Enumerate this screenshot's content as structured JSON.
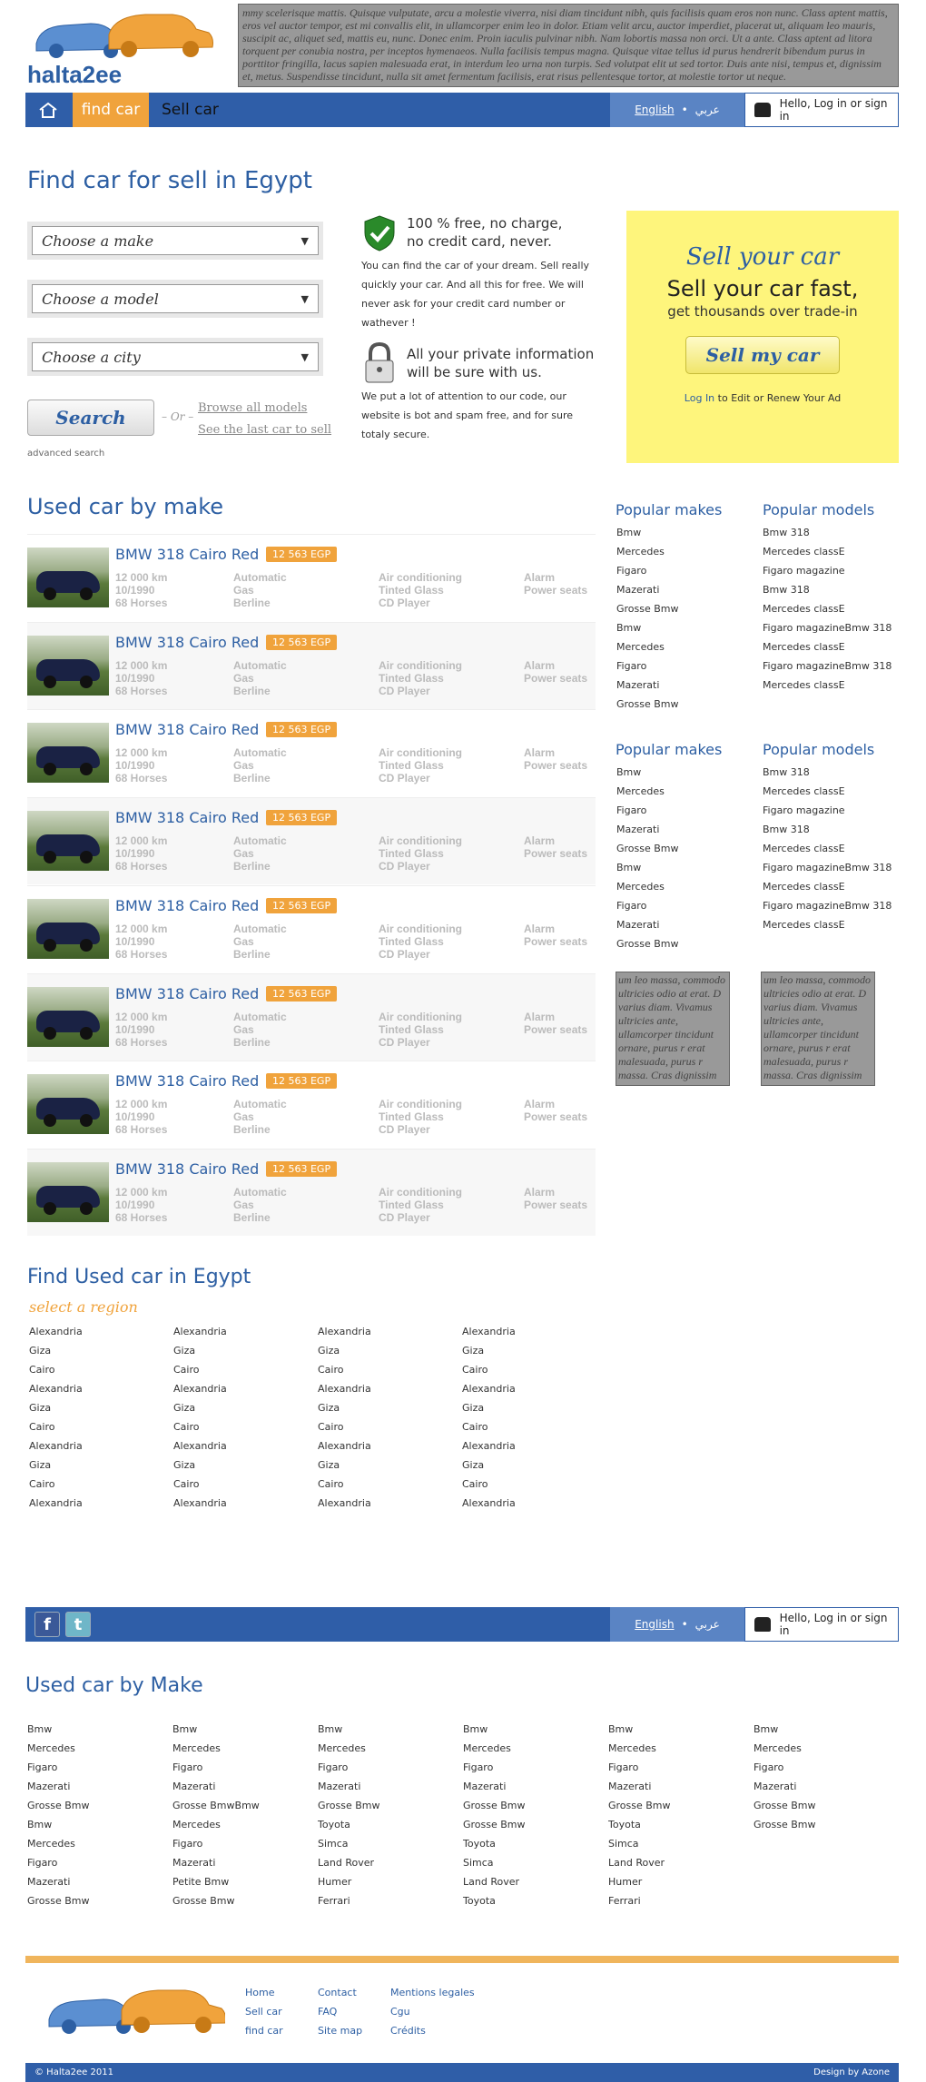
{
  "header": {
    "logo_text": "halta2ee",
    "lorem": "mmy scelerisque mattis. Quisque vulputate, arcu a molestie viverra, nisi diam tincidunt nibh, quis facilisis quam eros non nunc. Class aptent mattis, eros vel auctor tempor, est mi convallis elit, in ullamcorper enim leo in dolor. Etiam velit arcu, auctor imperdiet, placerat ut, aliquam leo mauris, suscipit ac, aliquet sed, mattis eu, nunc. Donec enim. Proin iaculis pulvinar nibh. Nam lobortis massa non orci. Ut a ante. Class aptent ad litora torquent per conubia nostra, per inceptos hymenaeos. Nulla facilisis tempus magna. Quisque vitae tellus id purus hendrerit bibendum purus in porttitor fringilla, lacus sapien malesuada erat, in interdum leo urna non turpis. Sed volutpat elit ut sed tortor. Duis ante nisi, tempus et, dignissim et, metus. Suspendisse tincidunt, nulla sit amet fermentum facilisis, erat risus pellentesque tortor, at molestie tortor ut neque."
  },
  "nav": {
    "home": "home",
    "find_car": "find car",
    "sell_car": "Sell car",
    "lang_en": "English",
    "lang_ar": "عربي",
    "hello": "Hello, Log in or sign in"
  },
  "search": {
    "title": "Find car for sell in Egypt",
    "make": "Choose a make",
    "model": "Choose a model",
    "city": "Choose a city",
    "button": "Search",
    "or": "– Or –",
    "browse": "Browse all models",
    "last": "See the last car to sell",
    "advanced": "advanced search"
  },
  "info": {
    "free_title_1": "100 % free, no charge,",
    "free_title_2": "no credit card, never.",
    "free_text": "You can find the car of your dream. Sell really quickly your car. And all this for free. We will never ask for your credit card number or wathever !",
    "private_title_1": "All your private information",
    "private_title_2": "will be sure with us.",
    "private_text": "We put a lot of attention to our code, our website is bot and spam free, and for sure totaly secure."
  },
  "sell_box": {
    "title": "Sell your car",
    "subtitle": "Sell your car fast,",
    "sub2": "get thousands over trade-in",
    "button": "Sell my car",
    "login": "Log In",
    "login_rest": " to Edit or Renew Your Ad"
  },
  "used_by_make": {
    "title": "Used car by make",
    "cars": [
      {
        "title": "BMW 318 Cairo Red",
        "price": "12 563 EGP",
        "c1": [
          "12 000 km",
          "10/1990",
          "68 Horses"
        ],
        "c2": [
          "Automatic",
          "Gas",
          "Berline"
        ],
        "c3": [
          "Air conditioning",
          "Tinted Glass",
          "CD Player"
        ],
        "c4": [
          "Alarm",
          "Power seats"
        ]
      },
      {
        "title": "BMW 318 Cairo Red",
        "price": "12 563 EGP",
        "c1": [
          "12 000 km",
          "10/1990",
          "68 Horses"
        ],
        "c2": [
          "Automatic",
          "Gas",
          "Berline"
        ],
        "c3": [
          "Air conditioning",
          "Tinted Glass",
          "CD Player"
        ],
        "c4": [
          "Alarm",
          "Power seats"
        ]
      },
      {
        "title": "BMW 318 Cairo Red",
        "price": "12 563 EGP",
        "c1": [
          "12 000 km",
          "10/1990",
          "68 Horses"
        ],
        "c2": [
          "Automatic",
          "Gas",
          "Berline"
        ],
        "c3": [
          "Air conditioning",
          "Tinted Glass",
          "CD Player"
        ],
        "c4": [
          "Alarm",
          "Power seats"
        ]
      },
      {
        "title": "BMW 318 Cairo Red",
        "price": "12 563 EGP",
        "c1": [
          "12 000 km",
          "10/1990",
          "68 Horses"
        ],
        "c2": [
          "Automatic",
          "Gas",
          "Berline"
        ],
        "c3": [
          "Air conditioning",
          "Tinted Glass",
          "CD Player"
        ],
        "c4": [
          "Alarm",
          "Power seats"
        ]
      },
      {
        "title": "BMW 318 Cairo Red",
        "price": "12 563 EGP",
        "c1": [
          "12 000 km",
          "10/1990",
          "68 Horses"
        ],
        "c2": [
          "Automatic",
          "Gas",
          "Berline"
        ],
        "c3": [
          "Air conditioning",
          "Tinted Glass",
          "CD Player"
        ],
        "c4": [
          "Alarm",
          "Power seats"
        ]
      },
      {
        "title": "BMW 318 Cairo Red",
        "price": "12 563 EGP",
        "c1": [
          "12 000 km",
          "10/1990",
          "68 Horses"
        ],
        "c2": [
          "Automatic",
          "Gas",
          "Berline"
        ],
        "c3": [
          "Air conditioning",
          "Tinted Glass",
          "CD Player"
        ],
        "c4": [
          "Alarm",
          "Power seats"
        ]
      },
      {
        "title": "BMW 318 Cairo Red",
        "price": "12 563 EGP",
        "c1": [
          "12 000 km",
          "10/1990",
          "68 Horses"
        ],
        "c2": [
          "Automatic",
          "Gas",
          "Berline"
        ],
        "c3": [
          "Air conditioning",
          "Tinted Glass",
          "CD Player"
        ],
        "c4": [
          "Alarm",
          "Power seats"
        ]
      },
      {
        "title": "BMW 318 Cairo Red",
        "price": "12 563 EGP",
        "c1": [
          "12 000 km",
          "10/1990",
          "68 Horses"
        ],
        "c2": [
          "Automatic",
          "Gas",
          "Berline"
        ],
        "c3": [
          "Air conditioning",
          "Tinted Glass",
          "CD Player"
        ],
        "c4": [
          "Alarm",
          "Power seats"
        ]
      }
    ]
  },
  "sidebar": {
    "makes_title": "Popular makes",
    "models_title": "Popular models",
    "makes": [
      "Bmw",
      "Mercedes",
      "Figaro",
      "Mazerati",
      "Grosse Bmw",
      "Bmw",
      "Mercedes",
      "Figaro",
      "Mazerati",
      "Grosse Bmw"
    ],
    "models": [
      "Bmw 318",
      "Mercedes classE",
      "Figaro magazine",
      "Bmw 318",
      "Mercedes classE",
      "Figaro magazineBmw 318",
      "Mercedes classE",
      "Figaro magazineBmw 318",
      "Mercedes classE"
    ],
    "ad_text": "um leo massa, commodo  ultricies odio at erat. D  varius diam. Vivamus  ultricies ante, ullamcorper  tincidunt ornare, purus r  erat malesuada, purus r  massa. Cras dignissim phar  ut. Integer dictum ornare"
  },
  "regions": {
    "title": "Find Used car in Egypt",
    "subtitle": "select a region",
    "cols": [
      [
        "Alexandria",
        "Giza",
        "Cairo",
        "Alexandria",
        "Giza",
        "Cairo",
        "Alexandria",
        "Giza",
        "Cairo",
        "Alexandria"
      ],
      [
        "Alexandria",
        "Giza",
        "Cairo",
        "Alexandria",
        "Giza",
        "Cairo",
        "Alexandria",
        "Giza",
        "Cairo",
        "Alexandria"
      ],
      [
        "Alexandria",
        "Giza",
        "Cairo",
        "Alexandria",
        "Giza",
        "Cairo",
        "Alexandria",
        "Giza",
        "Cairo",
        "Alexandria"
      ],
      [
        "Alexandria",
        "Giza",
        "Cairo",
        "Alexandria",
        "Giza",
        "Cairo",
        "Alexandria",
        "Giza",
        "Cairo",
        "Alexandria"
      ]
    ]
  },
  "footer_nav": {
    "facebook": "f",
    "twitter": "t",
    "lang_en": "English",
    "lang_ar": "عربي",
    "hello": "Hello, Log in or sign in"
  },
  "makes_footer": {
    "title": "Used car by Make",
    "cols": [
      [
        "Bmw",
        "Mercedes",
        "Figaro",
        "Mazerati",
        "Grosse Bmw",
        "Bmw",
        "Mercedes",
        "Figaro",
        "Mazerati",
        "Grosse Bmw"
      ],
      [
        "Bmw",
        "Mercedes",
        "Figaro",
        "Mazerati",
        "Grosse BmwBmw",
        "Mercedes",
        "Figaro",
        "Mazerati",
        "Petite Bmw",
        "Grosse Bmw"
      ],
      [
        "Bmw",
        "Mercedes",
        "Figaro",
        "Mazerati",
        "Grosse Bmw",
        "Toyota",
        "Simca",
        "Land Rover",
        "Humer",
        "Ferrari"
      ],
      [
        "Bmw",
        "Mercedes",
        "Figaro",
        "Mazerati",
        "Grosse Bmw",
        "Grosse Bmw",
        "Toyota",
        "Simca",
        "Land Rover",
        "Toyota"
      ],
      [
        "Bmw",
        "Mercedes",
        "Figaro",
        "Mazerati",
        "Grosse Bmw",
        "Toyota",
        "Simca",
        "Land Rover",
        "Humer",
        "Ferrari"
      ],
      [
        "Bmw",
        "Mercedes",
        "Figaro",
        "Mazerati",
        "Grosse Bmw",
        "Grosse Bmw"
      ]
    ]
  },
  "footer": {
    "links": [
      [
        "Home",
        "Sell car",
        "find car"
      ],
      [
        "Contact",
        "FAQ",
        "Site map"
      ],
      [
        "Mentions legales",
        "Cgu",
        "Crédits"
      ]
    ],
    "copyright": "© Halta2ee 2011",
    "design": "Design by Azone"
  },
  "colors": {
    "blue": "#2f5ea8",
    "orange": "#f0a33c",
    "yellow": "#fef57c"
  }
}
